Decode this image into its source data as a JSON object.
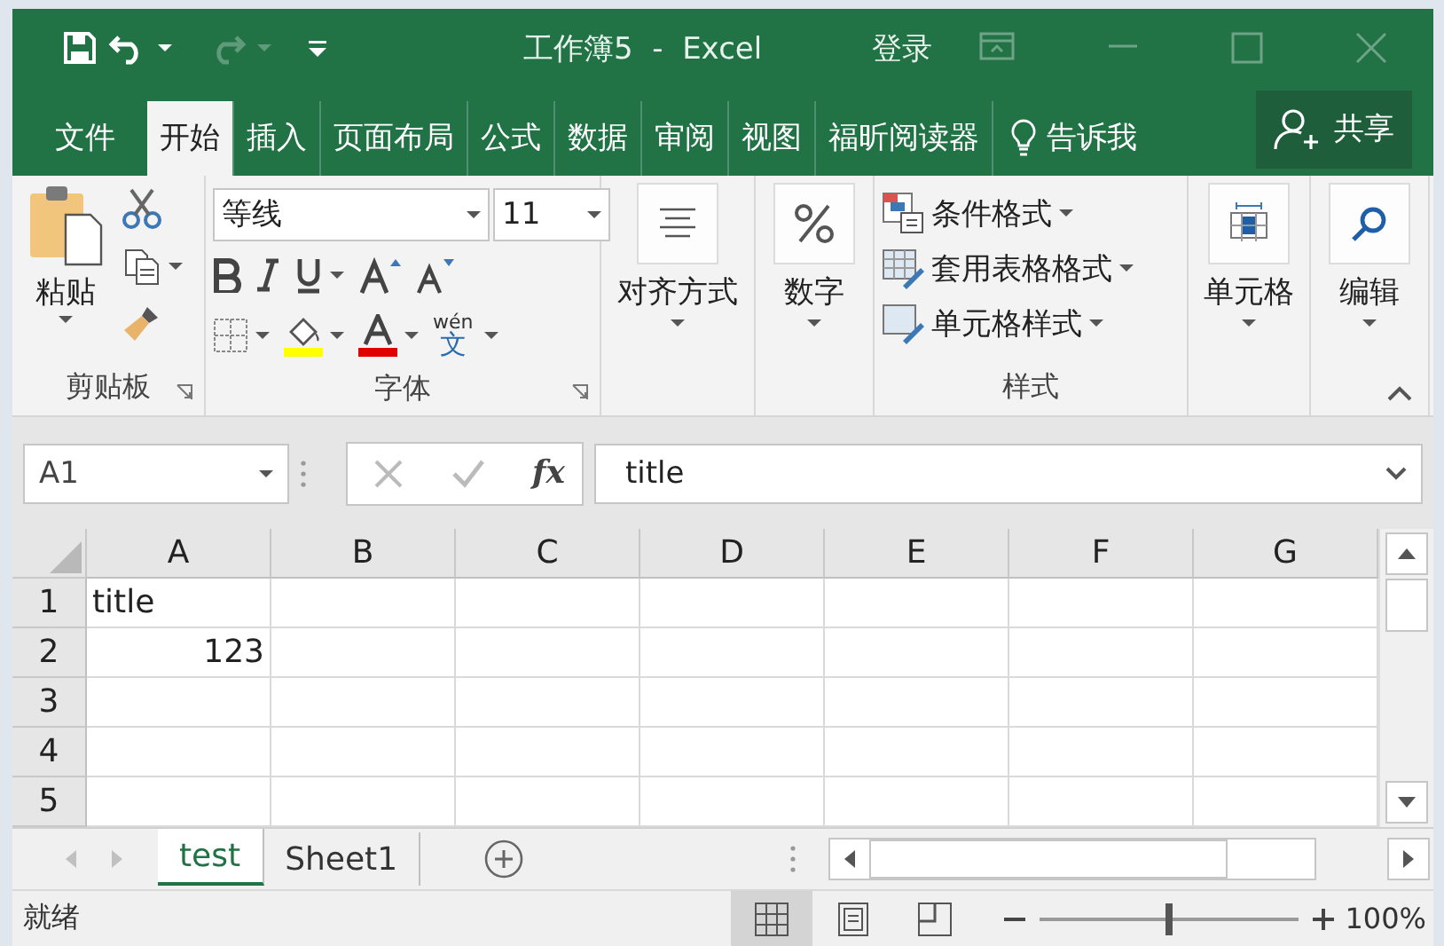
{
  "window": {
    "title": "工作簿5  -  Excel",
    "sign_in": "登录"
  },
  "quick_access": [
    {
      "kind": "save",
      "disabled": false
    },
    {
      "kind": "undo",
      "disabled": false
    },
    {
      "kind": "redo",
      "disabled": true
    },
    {
      "kind": "customize",
      "disabled": false
    }
  ],
  "tabs": [
    {
      "label": "文件",
      "selected": false
    },
    {
      "label": "开始",
      "selected": true
    },
    {
      "label": "插入",
      "selected": false
    },
    {
      "label": "页面布局",
      "selected": false
    },
    {
      "label": "公式",
      "selected": false
    },
    {
      "label": "数据",
      "selected": false
    },
    {
      "label": "审阅",
      "selected": false
    },
    {
      "label": "视图",
      "selected": false
    },
    {
      "label": "福昕阅读器",
      "selected": false
    }
  ],
  "tell_me": "告诉我",
  "share": "共享",
  "ribbon": {
    "clipboard": {
      "paste": "粘贴",
      "label": "剪贴板"
    },
    "font": {
      "font_name": "等线",
      "font_size": "11",
      "phonetic_top": "wén",
      "phonetic_bottom": "文",
      "label": "字体"
    },
    "alignment": "对齐方式",
    "number": "数字",
    "styles": {
      "items": [
        {
          "kind": "conditional",
          "label": "条件格式"
        },
        {
          "kind": "table",
          "label": "套用表格格式"
        },
        {
          "kind": "cell",
          "label": "单元格样式"
        }
      ],
      "label": "样式"
    },
    "cells": "单元格",
    "editing": "编辑"
  },
  "formula_bar": {
    "name_box": "A1",
    "function_button": "fx",
    "value": "title"
  },
  "sheet": {
    "columns": [
      "A",
      "B",
      "C",
      "D",
      "E",
      "F",
      "G"
    ],
    "rows": [
      {
        "number": "1",
        "cells": [
          {
            "kind": "text",
            "value": "title"
          }
        ]
      },
      {
        "number": "2",
        "cells": [
          {
            "kind": "number",
            "value": "123"
          }
        ]
      },
      {
        "number": "3",
        "cells": []
      },
      {
        "number": "4",
        "cells": []
      },
      {
        "number": "5",
        "cells": []
      }
    ]
  },
  "sheet_tabs": [
    {
      "label": "test",
      "selected": true
    },
    {
      "label": "Sheet1",
      "selected": false
    }
  ],
  "status_bar": {
    "text": "就绪",
    "views": [
      {
        "kind": "normal",
        "selected": true
      },
      {
        "kind": "page_layout",
        "selected": false
      },
      {
        "kind": "page_break",
        "selected": false
      }
    ],
    "zoom": {
      "level": 0.5
    },
    "zoom_text": "100%"
  }
}
